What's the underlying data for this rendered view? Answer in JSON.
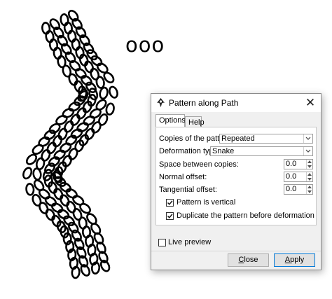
{
  "canvas": {
    "sample_text": "ooo"
  },
  "dialog": {
    "title": "Pattern along Path",
    "tabs": [
      "Options",
      "Help"
    ],
    "copies_label": "Copies of the pattern:",
    "copies_value": "Repeated",
    "deformation_label": "Deformation type:",
    "deformation_value": "Snake",
    "space_label": "Space between copies:",
    "space_value": "0.0",
    "normal_label": "Normal offset:",
    "normal_value": "0.0",
    "tangential_label": "Tangential offset:",
    "tangential_value": "0.0",
    "vertical_label": "Pattern is vertical",
    "vertical_checked": true,
    "duplicate_label": "Duplicate the pattern before deformation",
    "duplicate_checked": true,
    "live_preview_label": "Live preview",
    "live_preview_checked": false,
    "close_first": "C",
    "close_rest": "lose",
    "apply_first": "A",
    "apply_rest": "pply"
  }
}
